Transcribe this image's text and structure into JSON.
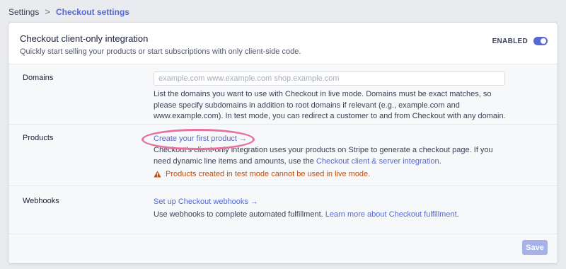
{
  "breadcrumb": {
    "root": "Settings",
    "separator": ">",
    "current": "Checkout settings"
  },
  "card": {
    "title": "Checkout client-only integration",
    "subtitle": "Quickly start selling your products or start subscriptions with only client-side code.",
    "toggle": {
      "label": "ENABLED",
      "enabled": true
    }
  },
  "domains": {
    "label": "Domains",
    "placeholder": "example.com www.example.com shop.example.com",
    "value": "",
    "help": "List the domains you want to use with Checkout in live mode. Domains must be exact matches, so please specify subdomains in addition to root domains if relevant (e.g., example.com and www.example.com). In test mode, you can redirect a customer to and from Checkout with any domain."
  },
  "products": {
    "label": "Products",
    "link": "Create your first product",
    "arrow": "→",
    "text_before": "Checkout's client-only integration uses your products on Stripe to generate a checkout page. If you need dynamic line items and amounts, use the ",
    "text_link": "Checkout client & server integration",
    "text_after": ".",
    "warning": "Products created in test mode cannot be used in live mode."
  },
  "webhooks": {
    "label": "Webhooks",
    "link": "Set up Checkout webhooks",
    "arrow": "→",
    "text_before": "Use webhooks to complete automated fulfillment. ",
    "text_link": "Learn more about Checkout fulfillment",
    "text_after": "."
  },
  "footer": {
    "save_label": "Save"
  },
  "colors": {
    "accent": "#5469d4",
    "warning": "#c44c0a",
    "highlight": "#e8719c",
    "save_disabled": "#a5b1e8"
  }
}
